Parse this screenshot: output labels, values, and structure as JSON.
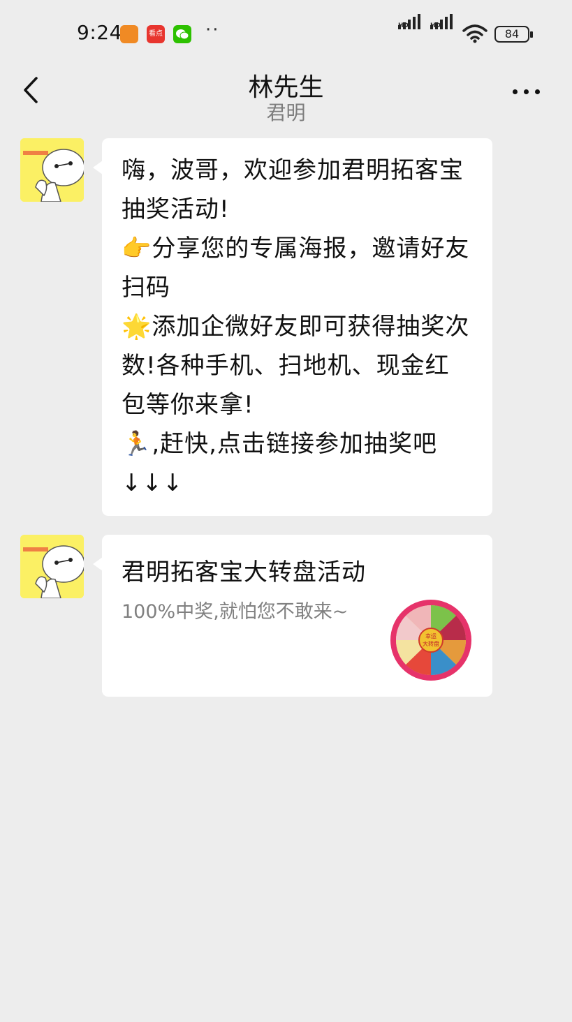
{
  "status_bar": {
    "time": "9:24",
    "app_icons": [
      "browser-icon",
      "kandian-icon",
      "wechat-icon"
    ],
    "app_icon_text": "看点",
    "more": "··",
    "signal_1": "HD",
    "signal_2": "HD",
    "battery": "84"
  },
  "header": {
    "title": "林先生",
    "subtitle": "君明"
  },
  "messages": [
    {
      "type": "text",
      "text": "嗨，波哥，欢迎参加君明拓客宝抽奖活动!\n👉分享您的专属海报，邀请好友扫码\n🌟添加企微好友即可获得抽奖次数!各种手机、扫地机、现金红包等你来拿!\n🏃,赶快,点击链接参加抽奖吧↓↓↓"
    },
    {
      "type": "link",
      "title": "君明拓客宝大转盘活动",
      "description": "100%中奖,就怕您不敢来~",
      "thumb_text": "幸运大转盘"
    }
  ],
  "colors": {
    "background": "#ededed",
    "bubble": "#ffffff",
    "avatar_bg": "#fbf064"
  }
}
